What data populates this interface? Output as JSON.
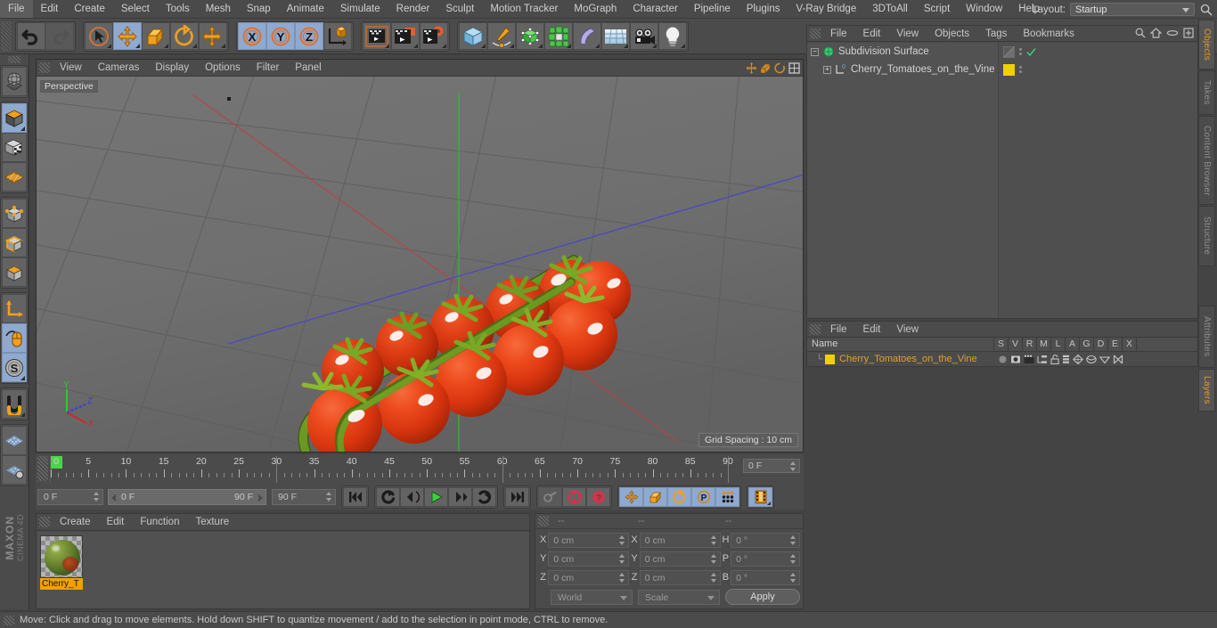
{
  "app": {
    "title": "CINEMA 4D",
    "brand_primary": "MAXON",
    "brand_secondary": "CINEMA 4D"
  },
  "menubar": {
    "items": [
      {
        "label": "File"
      },
      {
        "label": "Edit"
      },
      {
        "label": "Create"
      },
      {
        "label": "Select"
      },
      {
        "label": "Tools"
      },
      {
        "label": "Mesh"
      },
      {
        "label": "Snap"
      },
      {
        "label": "Animate"
      },
      {
        "label": "Simulate"
      },
      {
        "label": "Render"
      },
      {
        "label": "Sculpt"
      },
      {
        "label": "Motion Tracker"
      },
      {
        "label": "MoGraph"
      },
      {
        "label": "Character"
      },
      {
        "label": "Pipeline"
      },
      {
        "label": "Plugins"
      },
      {
        "label": "V-Ray Bridge"
      },
      {
        "label": "3DToAll"
      },
      {
        "label": "Script"
      },
      {
        "label": "Window"
      },
      {
        "label": "Help"
      }
    ],
    "layout_label": "Layout:",
    "layout_value": "Startup",
    "search_icon": "search-icon"
  },
  "toolbar": {
    "groups": [
      {
        "name": "history",
        "buttons": [
          {
            "name": "undo-button",
            "icon": "undo-arrow-icon",
            "state": "normal"
          },
          {
            "name": "redo-button",
            "icon": "redo-arrow-icon",
            "state": "dim"
          }
        ]
      },
      {
        "name": "transform-tools",
        "buttons": [
          {
            "name": "live-selection-tool",
            "icon": "cursor-circle-icon",
            "state": "normal"
          },
          {
            "name": "move-tool",
            "icon": "move-arrows-icon",
            "state": "active"
          },
          {
            "name": "scale-tool",
            "icon": "scale-box-icon",
            "state": "normal"
          },
          {
            "name": "rotate-tool",
            "icon": "rotate-arc-icon",
            "state": "normal"
          },
          {
            "name": "move-duplicate-tool",
            "icon": "move-arrows-icon",
            "state": "normal"
          }
        ]
      },
      {
        "name": "axis-locks",
        "buttons": [
          {
            "name": "lock-x-axis",
            "icon": "x-axis-icon",
            "state": "active",
            "label": "X"
          },
          {
            "name": "lock-y-axis",
            "icon": "y-axis-icon",
            "state": "active",
            "label": "Y"
          },
          {
            "name": "lock-z-axis",
            "icon": "z-axis-icon",
            "state": "active",
            "label": "Z"
          },
          {
            "name": "world-object-coordinates",
            "icon": "world-axis-cube-icon",
            "state": "normal"
          }
        ]
      },
      {
        "name": "render-group",
        "buttons": [
          {
            "name": "render-view-button",
            "icon": "clapperboard-view-icon",
            "state": "normal"
          },
          {
            "name": "render-to-picture-viewer-button",
            "icon": "clapperboard-picture-icon",
            "state": "normal"
          },
          {
            "name": "render-settings-button",
            "icon": "clapperboard-gear-icon",
            "state": "normal"
          }
        ]
      },
      {
        "name": "create-group",
        "buttons": [
          {
            "name": "add-cube-button",
            "icon": "blue-cube-icon",
            "state": "normal"
          },
          {
            "name": "add-spline-button",
            "icon": "pen-spline-icon",
            "state": "normal"
          },
          {
            "name": "add-generator-button",
            "icon": "green-cube-nurbs-icon",
            "state": "normal"
          },
          {
            "name": "add-array-button",
            "icon": "green-cluster-icon",
            "state": "normal"
          },
          {
            "name": "add-deformer-button",
            "icon": "purple-bend-icon",
            "state": "normal"
          },
          {
            "name": "add-scene-floor-button",
            "icon": "grid-floor-icon",
            "state": "normal"
          },
          {
            "name": "add-camera-button",
            "icon": "camera-icon",
            "state": "normal"
          },
          {
            "name": "add-light-button",
            "icon": "light-bulb-icon",
            "state": "normal"
          }
        ]
      }
    ]
  },
  "left_toolbar": {
    "buttons": [
      {
        "name": "make-editable-button",
        "icon": "globe-wire-icon",
        "state": "normal"
      },
      {
        "name": "model-mode-button",
        "icon": "model-cube-icon",
        "state": "active"
      },
      {
        "name": "texture-mode-button",
        "icon": "texture-checker-cube-icon",
        "state": "normal"
      },
      {
        "name": "workplane-mode-button",
        "icon": "orange-grid-plane-icon",
        "state": "normal"
      },
      {
        "name": "points-mode-button",
        "icon": "points-cube-icon",
        "state": "normal"
      },
      {
        "name": "edges-mode-button",
        "icon": "edges-cube-icon",
        "state": "normal"
      },
      {
        "name": "polygons-mode-button",
        "icon": "polygons-cube-icon",
        "state": "normal"
      },
      {
        "name": "object-axis-mode-button",
        "icon": "axis-corner-icon",
        "state": "normal"
      },
      {
        "name": "viewport-solo-button",
        "icon": "mouse-spline-icon",
        "state": "active"
      },
      {
        "name": "enable-snapping-button",
        "icon": "s-circle-icon",
        "state": "active"
      },
      {
        "name": "magnet-button",
        "icon": "magnet-icon",
        "state": "normal"
      },
      {
        "name": "workplane-button",
        "icon": "dotted-plane-icon",
        "state": "normal"
      },
      {
        "name": "workplane-lock-button",
        "icon": "dotted-plane-lock-icon",
        "state": "normal"
      }
    ]
  },
  "viewport": {
    "menu_items": [
      {
        "label": "View"
      },
      {
        "label": "Cameras"
      },
      {
        "label": "Display"
      },
      {
        "label": "Options"
      },
      {
        "label": "Filter"
      },
      {
        "label": "Panel"
      }
    ],
    "camera_label": "Perspective",
    "grid_spacing_label": "Grid Spacing : 10 cm",
    "axis_labels": {
      "x": "X",
      "y": "Y",
      "z": "Z"
    },
    "axis_colors": {
      "x": "#cc2a2a",
      "y": "#2ec92e",
      "z": "#3a3ad8"
    },
    "scene_description": "Cherry tomatoes on the vine 3D model",
    "background_color": "#6e6e6e",
    "tomato_color": "#e03a18",
    "vine_color": "#6f9c28",
    "tomato_count": 12,
    "icons": [
      "move-viewport-icon",
      "scale-viewport-icon",
      "rotate-viewport-icon",
      "maximize-viewport-icon"
    ]
  },
  "timeline": {
    "tick_labels": [
      "0",
      "5",
      "10",
      "15",
      "20",
      "25",
      "30",
      "35",
      "40",
      "45",
      "50",
      "55",
      "60",
      "65",
      "70",
      "75",
      "80",
      "85",
      "90"
    ],
    "range_min": 0,
    "range_max": 90,
    "current_frame_field": "0 F",
    "current_frame_left": "0 F",
    "range_start": "0 F",
    "range_end": "90 F",
    "max_frame_field": "90 F",
    "playhead_frame": "0 F",
    "transport_buttons": [
      {
        "name": "go-to-start-button",
        "icon": "skip-to-start-icon"
      },
      {
        "name": "loop-playback-button",
        "icon": "loop-arrow-icon"
      },
      {
        "name": "step-back-button",
        "icon": "step-back-icon"
      },
      {
        "name": "play-button",
        "icon": "play-triangle-icon"
      },
      {
        "name": "step-forward-button",
        "icon": "step-forward-icon"
      },
      {
        "name": "go-to-next-key-button",
        "icon": "next-key-icon"
      },
      {
        "name": "go-to-end-button",
        "icon": "skip-to-end-icon"
      }
    ],
    "key_buttons": [
      {
        "name": "record-active-objects-button",
        "icon": "key-grey-icon",
        "state": "dim"
      },
      {
        "name": "autokeying-button",
        "icon": "red-record-icon",
        "state": "normal"
      },
      {
        "name": "keyframe-selection-button",
        "icon": "red-question-icon",
        "state": "normal"
      }
    ],
    "anim_mode_buttons": [
      {
        "name": "record-position-button",
        "icon": "move-arrows-icon",
        "state": "active"
      },
      {
        "name": "record-scale-button",
        "icon": "scale-box-icon",
        "state": "active"
      },
      {
        "name": "record-rotation-button",
        "icon": "rotate-arc-icon",
        "state": "active"
      },
      {
        "name": "record-param-button",
        "icon": "p-circle-icon",
        "state": "active"
      },
      {
        "name": "record-pla-button",
        "icon": "dot-grid-icon",
        "state": "active"
      }
    ],
    "timeline_toggle": {
      "name": "animation-mode-button",
      "icon": "filmstrip-icon",
      "state": "active"
    }
  },
  "material_manager": {
    "menu_items": [
      {
        "label": "Create"
      },
      {
        "label": "Edit"
      },
      {
        "label": "Function"
      },
      {
        "label": "Texture"
      }
    ],
    "materials": [
      {
        "name": "Cherry_T",
        "selected": true,
        "swatch_color": "#f0a000"
      }
    ]
  },
  "coordinates": {
    "header_cols": [
      "--",
      "--",
      "--"
    ],
    "rows": [
      {
        "pos_label": "X",
        "pos_value": "0 cm",
        "size_label": "X",
        "size_value": "0 cm",
        "rot_label": "H",
        "rot_value": "0 °"
      },
      {
        "pos_label": "Y",
        "pos_value": "0 cm",
        "size_label": "Y",
        "size_value": "0 cm",
        "rot_label": "P",
        "rot_value": "0 °"
      },
      {
        "pos_label": "Z",
        "pos_value": "0 cm",
        "size_label": "Z",
        "size_value": "0 cm",
        "rot_label": "B",
        "rot_value": "0 °"
      }
    ],
    "coord_system": "World",
    "size_mode": "Scale",
    "apply_label": "Apply"
  },
  "object_manager": {
    "menu_items": [
      {
        "label": "File"
      },
      {
        "label": "Edit"
      },
      {
        "label": "View"
      },
      {
        "label": "Objects"
      },
      {
        "label": "Tags"
      },
      {
        "label": "Bookmarks"
      }
    ],
    "header_icons": [
      "search-icon",
      "home-icon",
      "ellipse-icon",
      "plus-box-icon"
    ],
    "objects": [
      {
        "name": "Subdivision Surface",
        "icon": "subdivision-surface-icon",
        "expanded": true,
        "indent": 0,
        "visibility_dots": true,
        "check_mark": true
      },
      {
        "name": "Cherry_Tomatoes_on_the_Vine",
        "icon": "polygon-object-icon",
        "expanded": false,
        "indent": 1,
        "tag_color": "#f0d000",
        "visibility_dots": true
      }
    ]
  },
  "layer_manager": {
    "menu_items": [
      {
        "label": "File"
      },
      {
        "label": "Edit"
      },
      {
        "label": "View"
      }
    ],
    "name_column": "Name",
    "columns": [
      "S",
      "V",
      "R",
      "M",
      "L",
      "A",
      "G",
      "D",
      "E",
      "X"
    ],
    "rows": [
      {
        "name": "Cherry_Tomatoes_on_the_Vine",
        "swatch": "#f0d000",
        "text_color": "#e0a030",
        "icons": [
          "solo-dot-icon",
          "visible-eye-icon",
          "render-clapper-icon",
          "manager-icon",
          "lock-open-icon",
          "animation-bars-icon",
          "generator-icon",
          "deformer-icon",
          "expression-icon",
          "xref-icon"
        ]
      }
    ]
  },
  "right_tabs": {
    "top_group": [
      {
        "label": "Objects",
        "active": true
      },
      {
        "label": "Takes",
        "active": false
      },
      {
        "label": "Content Browser",
        "active": false
      },
      {
        "label": "Structure",
        "active": false
      }
    ],
    "bottom_group": [
      {
        "label": "Attributes",
        "active": false
      },
      {
        "label": "Layers",
        "active": true
      }
    ]
  },
  "statusbar": {
    "message": "Move: Click and drag to move elements. Hold down SHIFT to quantize movement / add to the selection in point mode, CTRL to remove."
  }
}
